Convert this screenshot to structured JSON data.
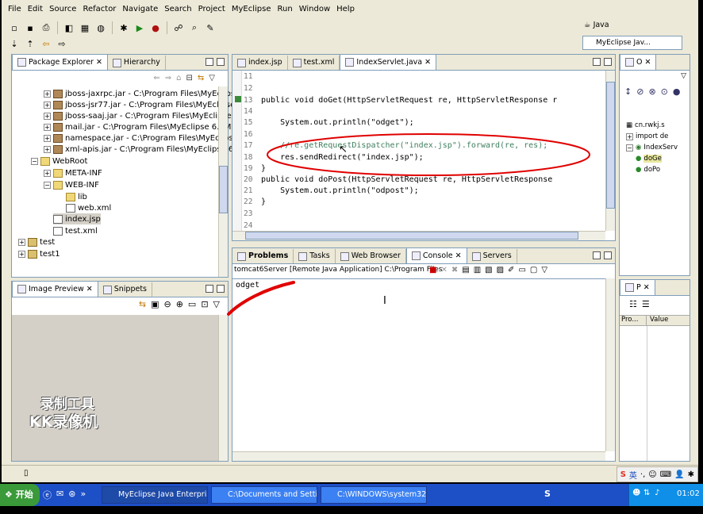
{
  "menu": [
    "File",
    "Edit",
    "Source",
    "Refactor",
    "Navigate",
    "Search",
    "Project",
    "MyEclipse",
    "Run",
    "Window",
    "Help"
  ],
  "perspective": {
    "java": "Java",
    "myeclipse": "MyEclipse Jav..."
  },
  "package_explorer": {
    "tabs": [
      "Package Explorer",
      "Hierarchy"
    ],
    "items": [
      "jboss-jaxrpc.jar - C:\\Program Files\\MyEclipse 6",
      "jboss-jsr77.jar - C:\\Program Files\\MyEclipse 6.",
      "jboss-saaj.jar - C:\\Program Files\\MyEclipse 6.5",
      "mail.jar - C:\\Program Files\\MyEclipse 6.5M1 Blu",
      "namespace.jar - C:\\Program Files\\MyEclipse 6.",
      "xml-apis.jar - C:\\Program Files\\MyEclipse 6.5M",
      "WebRoot",
      "META-INF",
      "WEB-INF",
      "lib",
      "web.xml",
      "index.jsp",
      "test.xml",
      "test",
      "test1"
    ]
  },
  "image_preview": {
    "tabs": [
      "Image Preview",
      "Snippets"
    ],
    "watermark1": "录制工具",
    "watermark2": "KK录像机"
  },
  "editor": {
    "tabs": [
      "index.jsp",
      "test.xml",
      "IndexServlet.java"
    ],
    "line_numbers": [
      "11",
      "12",
      "13",
      "14",
      "15",
      "16",
      "17",
      "18",
      "19",
      "20",
      "21",
      "22",
      "23",
      "24"
    ],
    "lines": [
      "",
      "",
      "public void doGet(HttpServletRequest re, HttpServletResponse r",
      "",
      "    System.out.println(\"odget\");",
      "",
      "    //re.getRequestDispatcher(\"index.jsp\").forward(re, res);",
      "    res.sendRedirect(\"index.jsp\");",
      "}",
      "public void doPost(HttpServletRequest re, HttpServletResponse",
      "    System.out.println(\"odpost\");",
      "}",
      "",
      ""
    ]
  },
  "console": {
    "tabs": [
      "Problems",
      "Tasks",
      "Web Browser",
      "Console",
      "Servers"
    ],
    "header": "tomcat6Server [Remote Java Application] C:\\Program Files",
    "output": "odget"
  },
  "outline": {
    "tab": "O",
    "items": [
      "cn.rwkj.s",
      "import de",
      "IndexServ",
      "doGe",
      "doPo"
    ]
  },
  "properties": {
    "tab": "P",
    "col_property": "Pro...",
    "col_value": "Value"
  },
  "taskbar": {
    "start": "开始",
    "buttons": [
      "MyEclipse Java Enterpris...",
      "C:\\Documents and Settin...",
      "C:\\WINDOWS\\system32..."
    ],
    "clock": "01:02",
    "ime": "英"
  },
  "colors": {
    "keyword": "#7f0055",
    "string": "#2a00ff",
    "comment": "#3f7f5f",
    "annotation": "#e00000"
  }
}
